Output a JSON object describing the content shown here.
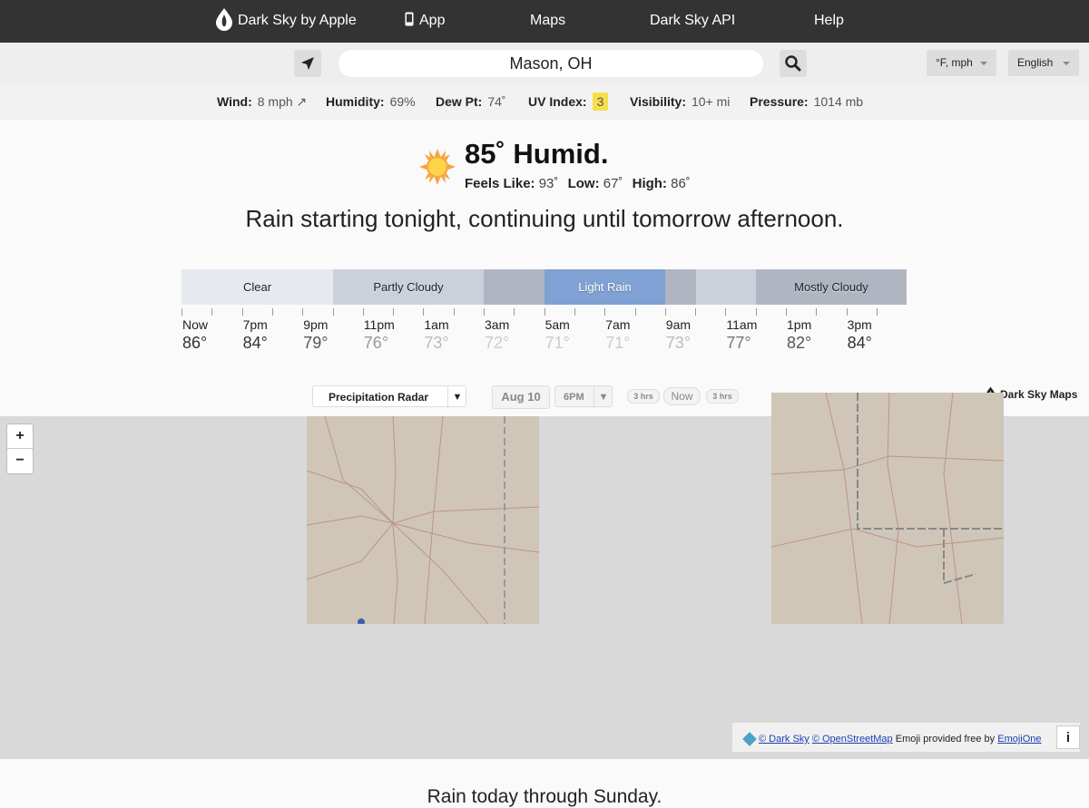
{
  "nav": {
    "brand": "Dark Sky by Apple",
    "app": "App",
    "maps": "Maps",
    "api": "Dark Sky API",
    "help": "Help"
  },
  "search": {
    "location": "Mason, OH",
    "units": "°F, mph",
    "language": "English"
  },
  "stats": {
    "wind_label": "Wind:",
    "wind_value": "8 mph ↗",
    "humidity_label": "Humidity:",
    "humidity_value": "69%",
    "dew_label": "Dew Pt:",
    "dew_value": "74˚",
    "uv_label": "UV Index:",
    "uv_value": "3",
    "visibility_label": "Visibility:",
    "visibility_value": "10+ mi",
    "pressure_label": "Pressure:",
    "pressure_value": "1014 mb"
  },
  "current": {
    "headline": "85˚ Humid.",
    "feels_label": "Feels Like:",
    "feels_value": "93˚",
    "low_label": "Low:",
    "low_value": "67˚",
    "high_label": "High:",
    "high_value": "86˚",
    "summary": "Rain starting tonight, continuing until tomorrow afternoon."
  },
  "timeline": {
    "segments": [
      {
        "label": "Clear",
        "color": "#e7e9f1"
      },
      {
        "label": "Partly Cloudy",
        "color": "#cbd1da"
      },
      {
        "label": "",
        "color": "#afb6c2"
      },
      {
        "label": "Light Rain",
        "color": "#7fa1d3"
      },
      {
        "label": "",
        "color": "#afb6c2"
      },
      {
        "label": "",
        "color": "#cbd1da"
      },
      {
        "label": "Mostly Cloudy",
        "color": "#afb6c2"
      }
    ],
    "hours": [
      "Now",
      "7pm",
      "9pm",
      "11pm",
      "1am",
      "3am",
      "5am",
      "7am",
      "9am",
      "11am",
      "1pm",
      "3pm"
    ],
    "temps": [
      "86°",
      "84°",
      "79°",
      "76°",
      "73°",
      "72°",
      "71°",
      "71°",
      "73°",
      "77°",
      "82°",
      "84°"
    ]
  },
  "map": {
    "layer": "Precipitation Radar",
    "date": "Aug 10",
    "time": "6PM",
    "back": "3 hrs",
    "now": "Now",
    "fwd": "3 hrs",
    "brand": "Dark Sky Maps",
    "zoom_in": "+",
    "zoom_out": "−",
    "credit_darksky": "© Dark Sky",
    "credit_osm": "© OpenStreetMap",
    "credit_emoji": "Emoji provided free by",
    "credit_emojione": "EmojiOne",
    "info": "i"
  },
  "week": {
    "summary": "Rain today through Sunday."
  }
}
